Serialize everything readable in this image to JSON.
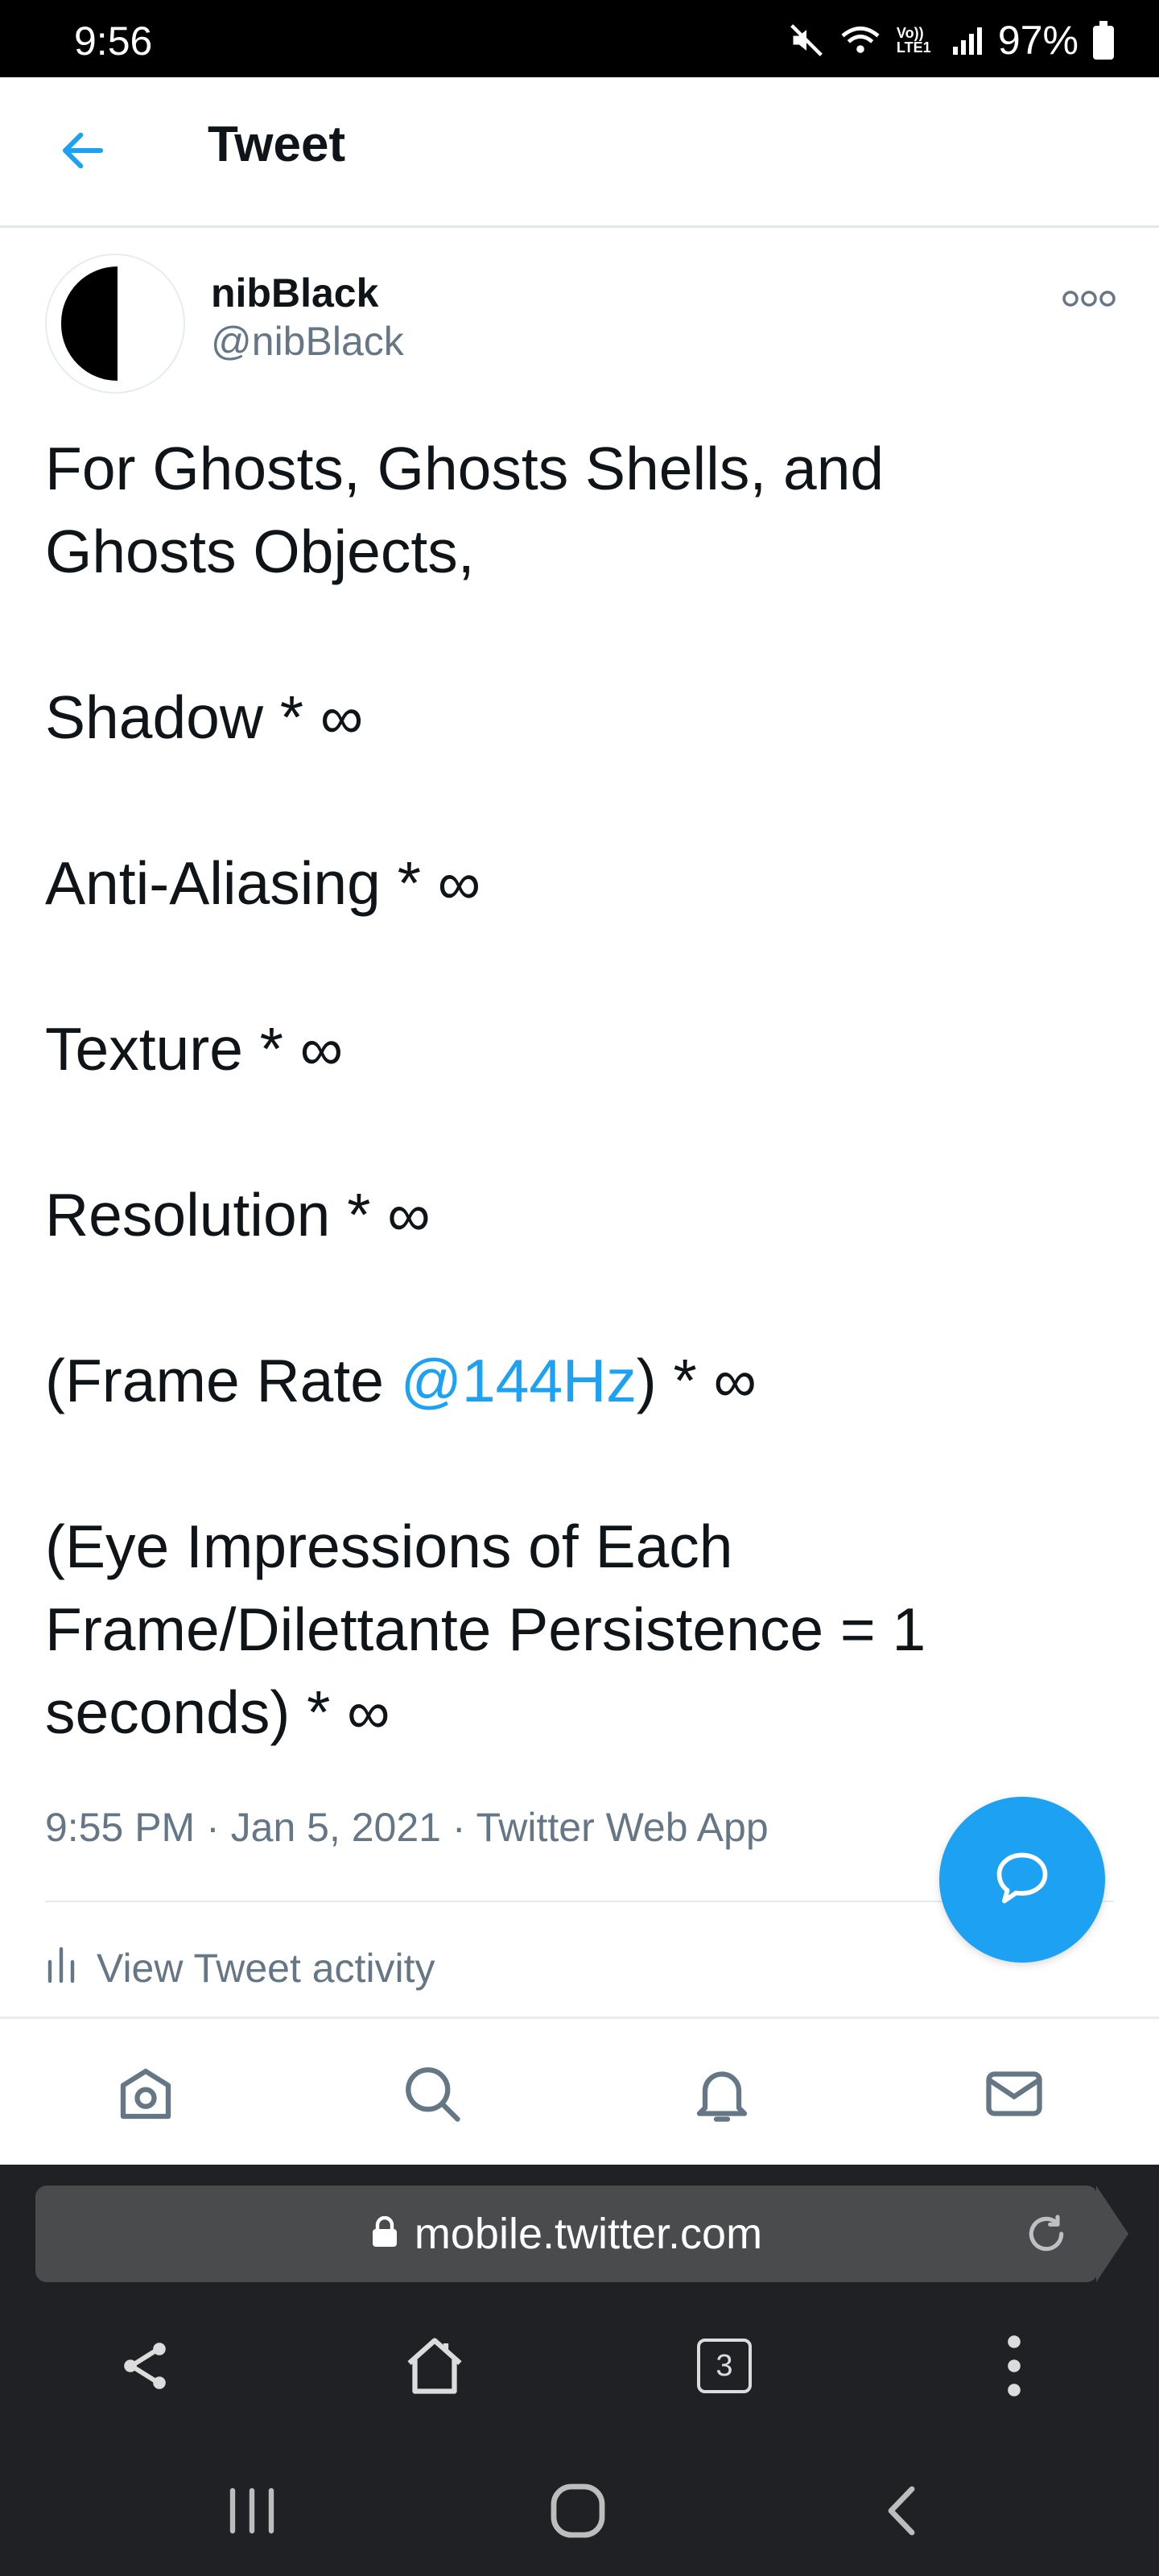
{
  "status_bar": {
    "time": "9:56",
    "battery_percent": "97%",
    "network_label": "Vo)) LTE1",
    "icons": [
      "mute-icon",
      "wifi-icon",
      "signal-icon",
      "battery-icon"
    ]
  },
  "header": {
    "title": "Tweet",
    "back_icon": "arrow-left-icon"
  },
  "tweet": {
    "display_name": "nibBlack",
    "handle": "@nibBlack",
    "text_parts": [
      "For Ghosts, Ghosts Shells, and\nGhosts Objects,\n\nShadow * ∞\n\nAnti-Aliasing * ∞\n\nTexture * ∞\n\nResolution * ∞\n\n(Frame Rate ",
      "@144Hz",
      ") * ∞\n\n(Eye Impressions of Each\nFrame/Dilettante Persistence = 1\nseconds) * ∞"
    ],
    "timestamp": "9:55 PM · Jan 5, 2021 · Twitter Web App",
    "activity_label": "View Tweet activity"
  },
  "colors": {
    "accent": "#1da1f2",
    "text_primary": "#0f1419",
    "text_secondary": "#657786",
    "browser_bg": "#202124"
  },
  "bottom_nav": {
    "items": [
      "home-icon",
      "search-icon",
      "notifications-icon",
      "messages-icon"
    ]
  },
  "browser": {
    "url": "mobile.twitter.com",
    "tab_count": "3"
  }
}
